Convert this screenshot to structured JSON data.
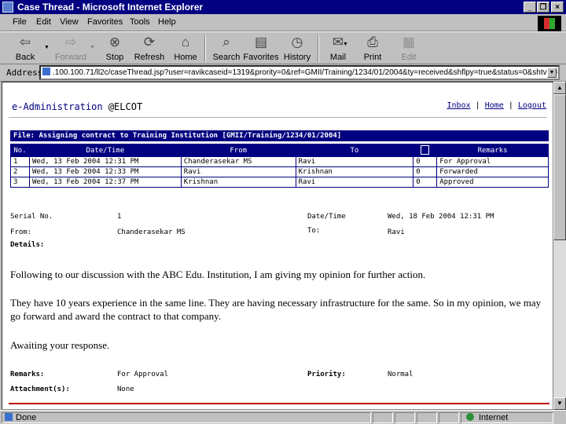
{
  "window": {
    "title": "Case Thread - Microsoft Internet Explorer",
    "min": "_",
    "max": "❐",
    "close": "×"
  },
  "menu": [
    "File",
    "Edit",
    "View",
    "Favorites",
    "Tools",
    "Help"
  ],
  "toolbar": {
    "back": "Back",
    "forward": "Forward",
    "stop": "Stop",
    "refresh": "Refresh",
    "home": "Home",
    "search": "Search",
    "favorites": "Favorites",
    "history": "History",
    "mail": "Mail",
    "print": "Print",
    "edit": "Edit"
  },
  "address": {
    "label": "Address",
    "url": ".100.100.71/ll2c/caseThread.jsp?user=ravikcaseid=1319&prority=0&ref=GMII/Training/1234/01/2004&ty=received&shflpy=true&status=0&shtvrk=0"
  },
  "page": {
    "brand": "e-Administration",
    "org": "@ELCOT",
    "links": {
      "inbox": "Inbox",
      "home": "Home",
      "logout": "Logout",
      "sep": "|"
    }
  },
  "thread": {
    "file_label": "File: Assigning contract to Training Institution [GMII/Training/1234/01/2004]",
    "columns": [
      "No.",
      "Date/Time",
      "From",
      "To",
      "",
      "Remarks"
    ],
    "rows": [
      {
        "no": "1",
        "date": "Wed, 13 Feb 2004 12:31 PM",
        "from": "Chanderasekar MS",
        "to": "Ravi",
        "flag": "0",
        "remarks": "For Approval"
      },
      {
        "no": "2",
        "date": "Wed, 13 Feb 2004 12:33 PM",
        "from": "Ravi",
        "to": "Krishnan",
        "flag": "0",
        "remarks": "Forwarded"
      },
      {
        "no": "3",
        "date": "Wed, 13 Feb 2004 12:37 PM",
        "from": "Krishnan",
        "to": "Ravi",
        "flag": "0",
        "remarks": "Approved"
      }
    ]
  },
  "detail": {
    "serial_label": "Serial No.",
    "serial": "1",
    "datetime_label": "Date/Time",
    "datetime": "Wed, 18 Feb 2004 12:31 PM",
    "from_label": "From:",
    "from": "Chanderasekar MS",
    "to_label": "To:",
    "to": "Ravi",
    "details_label": "Details:",
    "body": [
      "Following to our discussion with the ABC Edu. Institution, I am giving my opinion for further action.",
      "They have 10 years experience in the same line. They are having necessary infrastructure for the same. So in my opinion, we may go forward and award the contract to that company.",
      "Awaiting your response."
    ],
    "remarks_label": "Remarks:",
    "remarks": "For Approval",
    "priority_label": "Priority:",
    "priority": "Normal",
    "attach_label": "Attachment(s):",
    "attach": "None"
  },
  "status": {
    "text": "Done",
    "zone": "Internet"
  }
}
